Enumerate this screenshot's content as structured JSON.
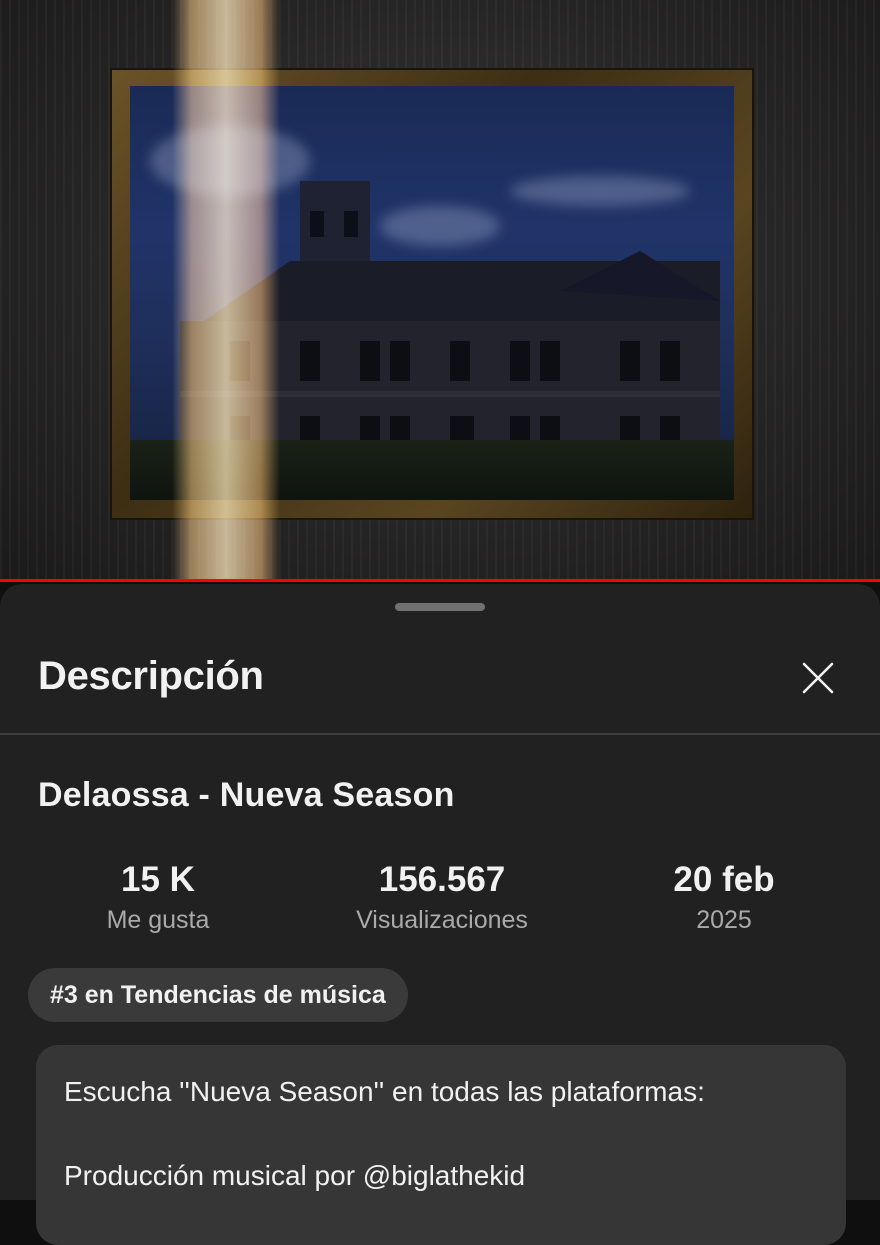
{
  "video": {
    "progress_fraction": 1.0,
    "progress_color": "#ff0000"
  },
  "sheet": {
    "title": "Descripción",
    "close_icon": "close-icon"
  },
  "video_title": "Delaossa - Nueva Season",
  "stats": [
    {
      "value": "15 K",
      "label": "Me gusta"
    },
    {
      "value": "156.567",
      "label": "Visualizaciones"
    },
    {
      "value": "20 feb",
      "label": "2025"
    }
  ],
  "chip": {
    "label": "#3 en Tendencias de música"
  },
  "description": {
    "line1": "Escucha ''Nueva Season'' en todas las plataformas:",
    "line2": "Producción musical por @biglathekid"
  },
  "colors": {
    "background": "#0f0f0f",
    "sheet": "#212121",
    "chip": "#3a3a3a",
    "description_box": "#363636",
    "secondary_text": "#aaaaaa"
  }
}
